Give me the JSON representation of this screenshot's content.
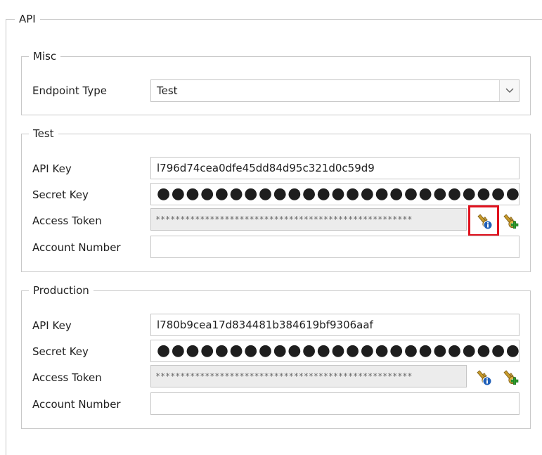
{
  "api": {
    "title": "API",
    "misc": {
      "title": "Misc",
      "endpoint_type_label": "Endpoint Type",
      "endpoint_type_value": "Test"
    },
    "test": {
      "title": "Test",
      "api_key_label": "API Key",
      "api_key_value": "l796d74cea0dfe45dd84d95c321d0c59d9",
      "secret_key_label": "Secret Key",
      "secret_key_value": "●●●●●●●●●●●●●●●●●●●●●●●●●●●●●●●●",
      "access_token_label": "Access Token",
      "access_token_value": "****************************************************",
      "account_number_label": "Account Number",
      "account_number_value": ""
    },
    "production": {
      "title": "Production",
      "api_key_label": "API Key",
      "api_key_value": "l780b9cea17d834481b384619bf9306aaf",
      "secret_key_label": "Secret Key",
      "secret_key_value": "●●●●●●●●●●●●●●●●●●●●●●●●●●●●●●●●",
      "access_token_label": "Access Token",
      "access_token_value": "****************************************************",
      "account_number_label": "Account Number",
      "account_number_value": ""
    }
  },
  "icons": {
    "token_info": "key-info-icon",
    "token_add": "key-add-icon",
    "dropdown": "chevron-down-icon"
  },
  "colors": {
    "highlight": "#e0121e",
    "border": "#c6c6c6",
    "readonly_bg": "#ececec"
  }
}
